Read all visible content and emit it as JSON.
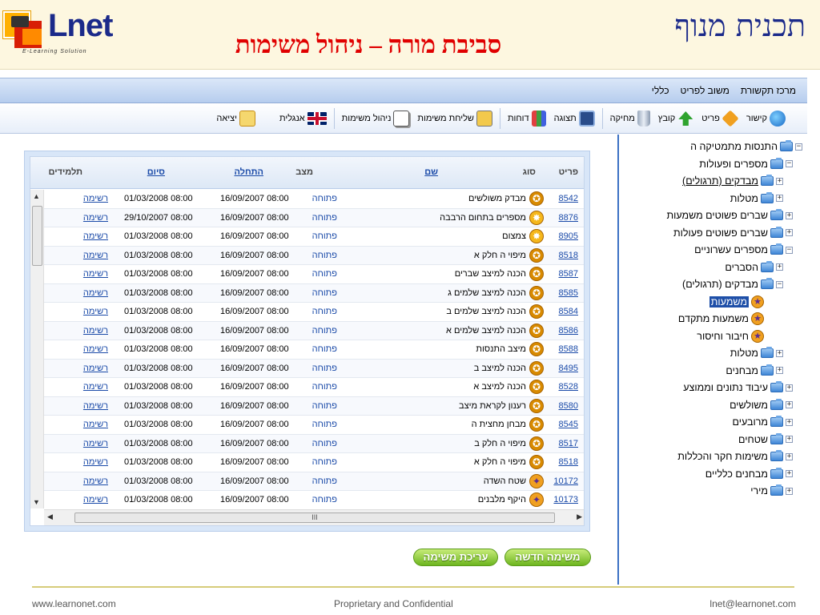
{
  "slide": {
    "title": "סביבת מורה – ניהול משימות",
    "corner_title": "תכנית מנוף",
    "logo_text": "Lnet",
    "logo_subtitle": "E-Learning Solution"
  },
  "menubar": {
    "items": [
      "מרכז תקשורת",
      "משוב לפריט",
      "כללי"
    ]
  },
  "toolbar": {
    "items": [
      {
        "label": "קישור",
        "icon": "globe-icon"
      },
      {
        "label": "פריט",
        "icon": "link-icon"
      },
      {
        "label": "קובץ",
        "icon": "upload-icon"
      },
      {
        "label": "מחיקה",
        "icon": "trash-icon"
      },
      {
        "label": "תצוגה",
        "icon": "view-icon"
      },
      {
        "label": "דוחות",
        "icon": "reports-icon"
      },
      {
        "label": "שליחת משימות",
        "icon": "send-tasks-icon"
      },
      {
        "label": "ניהול משימות",
        "icon": "manage-tasks-icon"
      },
      {
        "label": "אנגלית",
        "icon": "uk-flag-icon"
      },
      {
        "label": "יציאה",
        "icon": "exit-icon"
      }
    ]
  },
  "tree": {
    "nodes": [
      {
        "label": "התנסות מתמטיקה ה",
        "toggle": "−",
        "icon": "folder"
      },
      {
        "label": "מספרים ופעולות",
        "toggle": "−",
        "icon": "folder"
      },
      {
        "label": "מבדקים (תרגולים)",
        "toggle": "+",
        "icon": "folder"
      },
      {
        "label": "מטלות",
        "toggle": "+",
        "icon": "folder"
      },
      {
        "label": "שברים פשוטים משמעות",
        "toggle": "+",
        "icon": "folder"
      },
      {
        "label": "שברים פשוטים פעולות",
        "toggle": "+",
        "icon": "folder"
      },
      {
        "label": "מספרים עשרוניים",
        "toggle": "−",
        "icon": "folder"
      },
      {
        "label": "הסברים",
        "toggle": "+",
        "icon": "folder"
      },
      {
        "label": "מבדקים (תרגולים)",
        "toggle": "−",
        "icon": "folder"
      },
      {
        "label": "משמעות",
        "toggle": "",
        "icon": "star"
      },
      {
        "label": "משמעות מתקדם",
        "toggle": "",
        "icon": "star"
      },
      {
        "label": "חיבור וחיסור",
        "toggle": "",
        "icon": "star"
      },
      {
        "label": "מטלות",
        "toggle": "+",
        "icon": "folder"
      },
      {
        "label": "מבחנים",
        "toggle": "+",
        "icon": "folder"
      },
      {
        "label": "עיבוד נתונים וממוצע",
        "toggle": "+",
        "icon": "folder"
      },
      {
        "label": "משולשים",
        "toggle": "+",
        "icon": "folder"
      },
      {
        "label": "מרובעים",
        "toggle": "+",
        "icon": "folder"
      },
      {
        "label": "שטחים",
        "toggle": "+",
        "icon": "folder"
      },
      {
        "label": "משימות חקר והכללות",
        "toggle": "+",
        "icon": "folder"
      },
      {
        "label": "מבחנים כלליים",
        "toggle": "+",
        "icon": "folder"
      },
      {
        "label": "מירי",
        "toggle": "+",
        "icon": "folder"
      }
    ]
  },
  "table": {
    "headers": {
      "id": "פריט",
      "type": "סוג",
      "name": "שם",
      "state": "מצב",
      "start": "התחלה",
      "end": "סיום",
      "students": "תלמידים"
    },
    "rows": [
      {
        "id": "8542",
        "type": "badge",
        "name": "מבדק משולשים",
        "state": "פתוחה",
        "start": "16/09/2007 08:00",
        "end": "01/03/2008 08:00",
        "students": "רשימה"
      },
      {
        "id": "8876",
        "type": "star",
        "name": "מספרים בתחום הרבבה",
        "state": "פתוחה",
        "start": "16/09/2007 08:00",
        "end": "29/10/2007 08:00",
        "students": "רשימה"
      },
      {
        "id": "8905",
        "type": "star",
        "name": "צמצום",
        "state": "פתוחה",
        "start": "16/09/2007 08:00",
        "end": "01/03/2008 08:00",
        "students": "רשימה"
      },
      {
        "id": "8518",
        "type": "badge",
        "name": "מיפוי ה חלק א",
        "state": "פתוחה",
        "start": "16/09/2007 08:00",
        "end": "01/03/2008 08:00",
        "students": "רשימה"
      },
      {
        "id": "8587",
        "type": "badge",
        "name": "הכנה למיצב שברים",
        "state": "פתוחה",
        "start": "16/09/2007 08:00",
        "end": "01/03/2008 08:00",
        "students": "רשימה"
      },
      {
        "id": "8585",
        "type": "badge",
        "name": "הכנה למיצב שלמים ג",
        "state": "פתוחה",
        "start": "16/09/2007 08:00",
        "end": "01/03/2008 08:00",
        "students": "רשימה"
      },
      {
        "id": "8584",
        "type": "badge",
        "name": "הכנה למיצב שלמים ב",
        "state": "פתוחה",
        "start": "16/09/2007 08:00",
        "end": "01/03/2008 08:00",
        "students": "רשימה"
      },
      {
        "id": "8586",
        "type": "badge",
        "name": "הכנה למיצב שלמים א",
        "state": "פתוחה",
        "start": "16/09/2007 08:00",
        "end": "01/03/2008 08:00",
        "students": "רשימה"
      },
      {
        "id": "8588",
        "type": "badge",
        "name": "מיצב התנסות",
        "state": "פתוחה",
        "start": "16/09/2007 08:00",
        "end": "01/03/2008 08:00",
        "students": "רשימה"
      },
      {
        "id": "8495",
        "type": "badge",
        "name": "הכנה למיצב ב",
        "state": "פתוחה",
        "start": "16/09/2007 08:00",
        "end": "01/03/2008 08:00",
        "students": "רשימה"
      },
      {
        "id": "8528",
        "type": "badge",
        "name": "הכנה למיצב א",
        "state": "פתוחה",
        "start": "16/09/2007 08:00",
        "end": "01/03/2008 08:00",
        "students": "רשימה"
      },
      {
        "id": "8580",
        "type": "badge",
        "name": "רענון לקראת מיצב",
        "state": "פתוחה",
        "start": "16/09/2007 08:00",
        "end": "01/03/2008 08:00",
        "students": "רשימה"
      },
      {
        "id": "8545",
        "type": "badge",
        "name": "מבחן מחצית ה",
        "state": "פתוחה",
        "start": "16/09/2007 08:00",
        "end": "01/03/2008 08:00",
        "students": "רשימה"
      },
      {
        "id": "8517",
        "type": "badge",
        "name": "מיפוי ה חלק ב",
        "state": "פתוחה",
        "start": "16/09/2007 08:00",
        "end": "01/03/2008 08:00",
        "students": "רשימה"
      },
      {
        "id": "8518",
        "type": "badge",
        "name": "מיפוי ה חלק א",
        "state": "פתוחה",
        "start": "16/09/2007 08:00",
        "end": "01/03/2008 08:00",
        "students": "רשימה"
      },
      {
        "id": "10172",
        "type": "circle",
        "name": "שטח השדה",
        "state": "פתוחה",
        "start": "16/09/2007 08:00",
        "end": "01/03/2008 08:00",
        "students": "רשימה"
      },
      {
        "id": "10173",
        "type": "circle",
        "name": "היקף מלבנים",
        "state": "פתוחה",
        "start": "16/09/2007 08:00",
        "end": "01/03/2008 08:00",
        "students": "רשימה"
      }
    ]
  },
  "buttons": {
    "new_task": "משימה חדשה",
    "edit_task": "עריכת משימה"
  },
  "footer": {
    "left": "www.learnonet.com",
    "center": "Proprietary and Confidential",
    "right": "lnet@learnonet.com"
  },
  "scrollbar": {
    "grip": "III"
  }
}
